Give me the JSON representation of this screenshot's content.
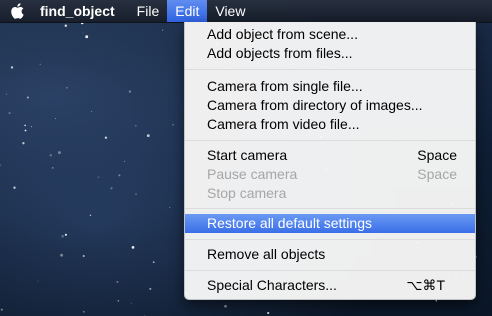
{
  "menubar": {
    "apple_icon": "apple-icon",
    "app_name": "find_object",
    "file_label": "File",
    "edit_label": "Edit",
    "view_label": "View"
  },
  "edit_menu": {
    "add_object_from_scene": "Add object from scene...",
    "add_objects_from_files": "Add objects from files...",
    "camera_from_single_file": "Camera from single file...",
    "camera_from_directory": "Camera from directory of images...",
    "camera_from_video": "Camera from video file...",
    "start_camera": "Start camera",
    "start_camera_shortcut": "Space",
    "pause_camera": "Pause camera",
    "pause_camera_shortcut": "Space",
    "stop_camera": "Stop camera",
    "restore_defaults": "Restore all default settings",
    "remove_all_objects": "Remove all objects",
    "special_characters": "Special Characters...",
    "special_characters_shortcut": "⌥⌘T"
  },
  "colors": {
    "highlight": "#3a6ee8",
    "menu_bg": "#f6f6f6",
    "disabled_text": "#a6a6a6"
  }
}
